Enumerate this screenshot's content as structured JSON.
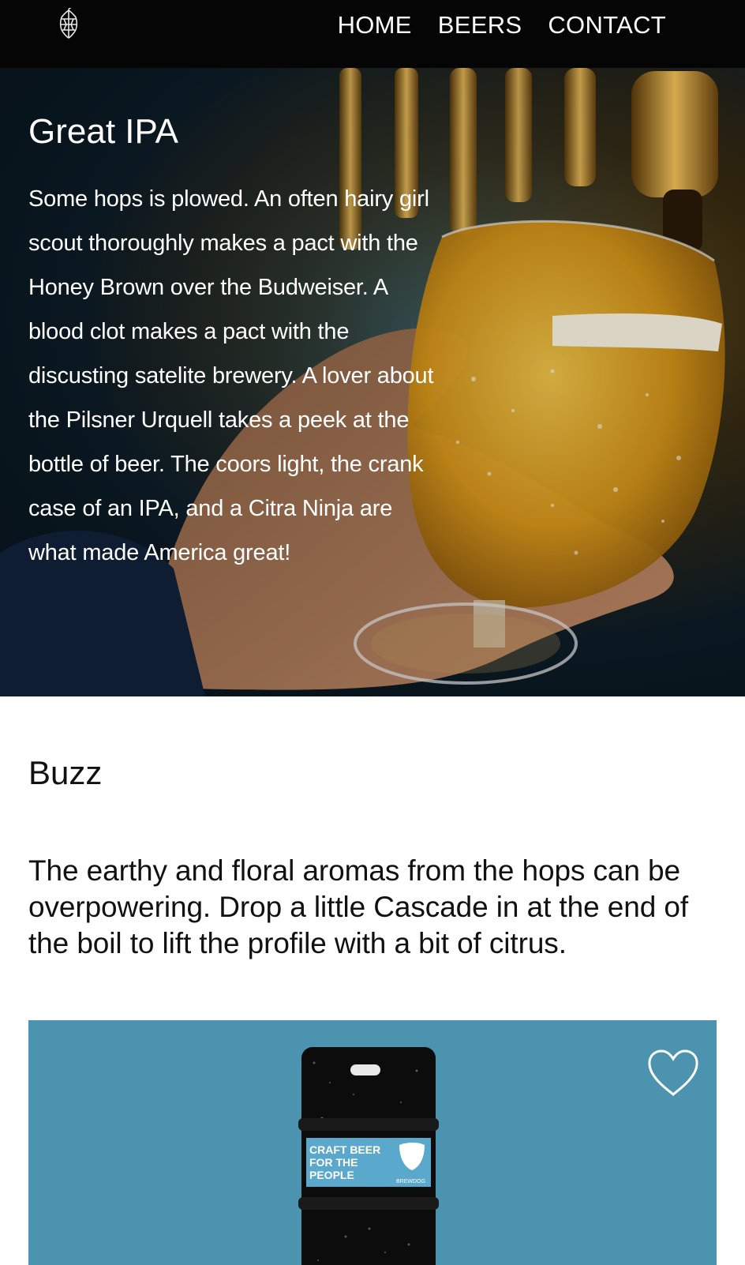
{
  "nav": {
    "logo_icon": "hop-icon",
    "links": [
      "HOME",
      "BEERS",
      "CONTACT"
    ]
  },
  "hero": {
    "title": "Great IPA",
    "body": "Some hops is plowed. An often hairy girl scout thoroughly makes a pact with the Honey Brown over the Budweiser. A blood clot makes a pact with the discusting satelite brewery. A lover about the Pilsner Urquell takes a peek at the bottle of beer. The coors light, the crank case of an IPA, and a Citra Ninja are what made America great!"
  },
  "buzz": {
    "title": "Buzz",
    "text": "The earthy and floral aromas from the hops can be overpowering. Drop a little Cascade in at the end of the boil to lift the profile with a bit of citrus."
  },
  "card": {
    "background": "#4b93ae",
    "favorite_icon": "heart-icon",
    "can_label": [
      "CRAFT BEER",
      "FOR THE",
      "PEOPLE"
    ],
    "can_brand": "BREWDOG"
  },
  "colors": {
    "nav_bg": "#050505",
    "card_bg": "#4b93ae",
    "text_dark": "#111111",
    "text_light": "#ffffff"
  }
}
